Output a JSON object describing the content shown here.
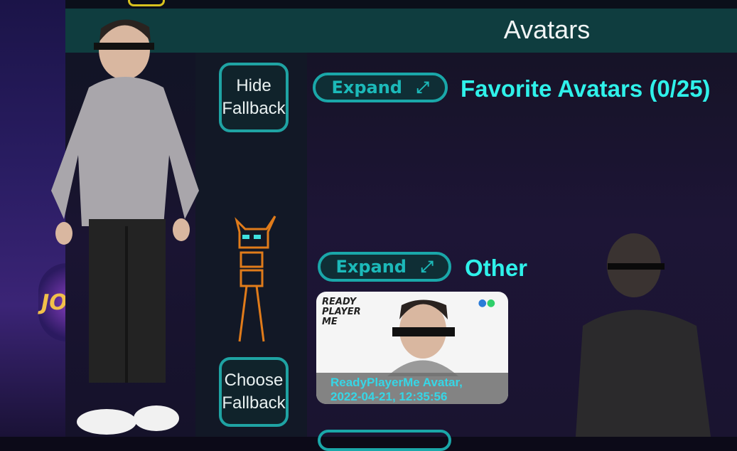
{
  "header": {
    "title": "Avatars"
  },
  "sidebar": {
    "hide_fallback_label": "Hide\nFallback",
    "choose_fallback_label": "Choose\nFallback"
  },
  "sections": [
    {
      "expand_label": "Expand",
      "expand_icon": "expand-arrows-icon",
      "title": "Favorite Avatars (0/25)"
    },
    {
      "expand_label": "Expand",
      "expand_icon": "expand-arrows-icon",
      "title": "Other"
    }
  ],
  "avatar_card": {
    "logo_text": "READY\nPLAYER\nME",
    "name": "ReadyPlayerMe Avatar,",
    "timestamp": "2022-04-21, 12:35:56"
  },
  "scene": {
    "sign_text": "JOK"
  },
  "colors": {
    "accent": "#1aa7a9",
    "title_cyan": "#2ff1ea",
    "header_bg": "#0f3d3f"
  }
}
